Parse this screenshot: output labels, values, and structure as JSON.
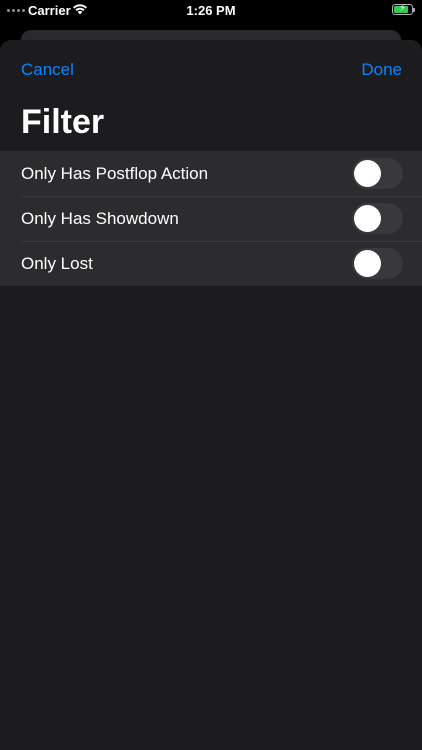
{
  "status_bar": {
    "carrier": "Carrier",
    "time": "1:26 PM",
    "battery_level": 0.85,
    "icons": [
      "signal-dots-icon",
      "wifi-icon",
      "battery-charging-icon"
    ]
  },
  "nav": {
    "cancel_label": "Cancel",
    "done_label": "Done"
  },
  "title": "Filter",
  "filters": [
    {
      "label": "Only Has Postflop Action",
      "enabled": false
    },
    {
      "label": "Only Has Showdown",
      "enabled": false
    },
    {
      "label": "Only Lost",
      "enabled": false
    }
  ],
  "colors": {
    "accent": "#0a84ff",
    "sheet_background": "#1c1c1e",
    "row_background": "#2c2c2e",
    "toggle_off": "#39393d",
    "battery": "#34c759"
  }
}
